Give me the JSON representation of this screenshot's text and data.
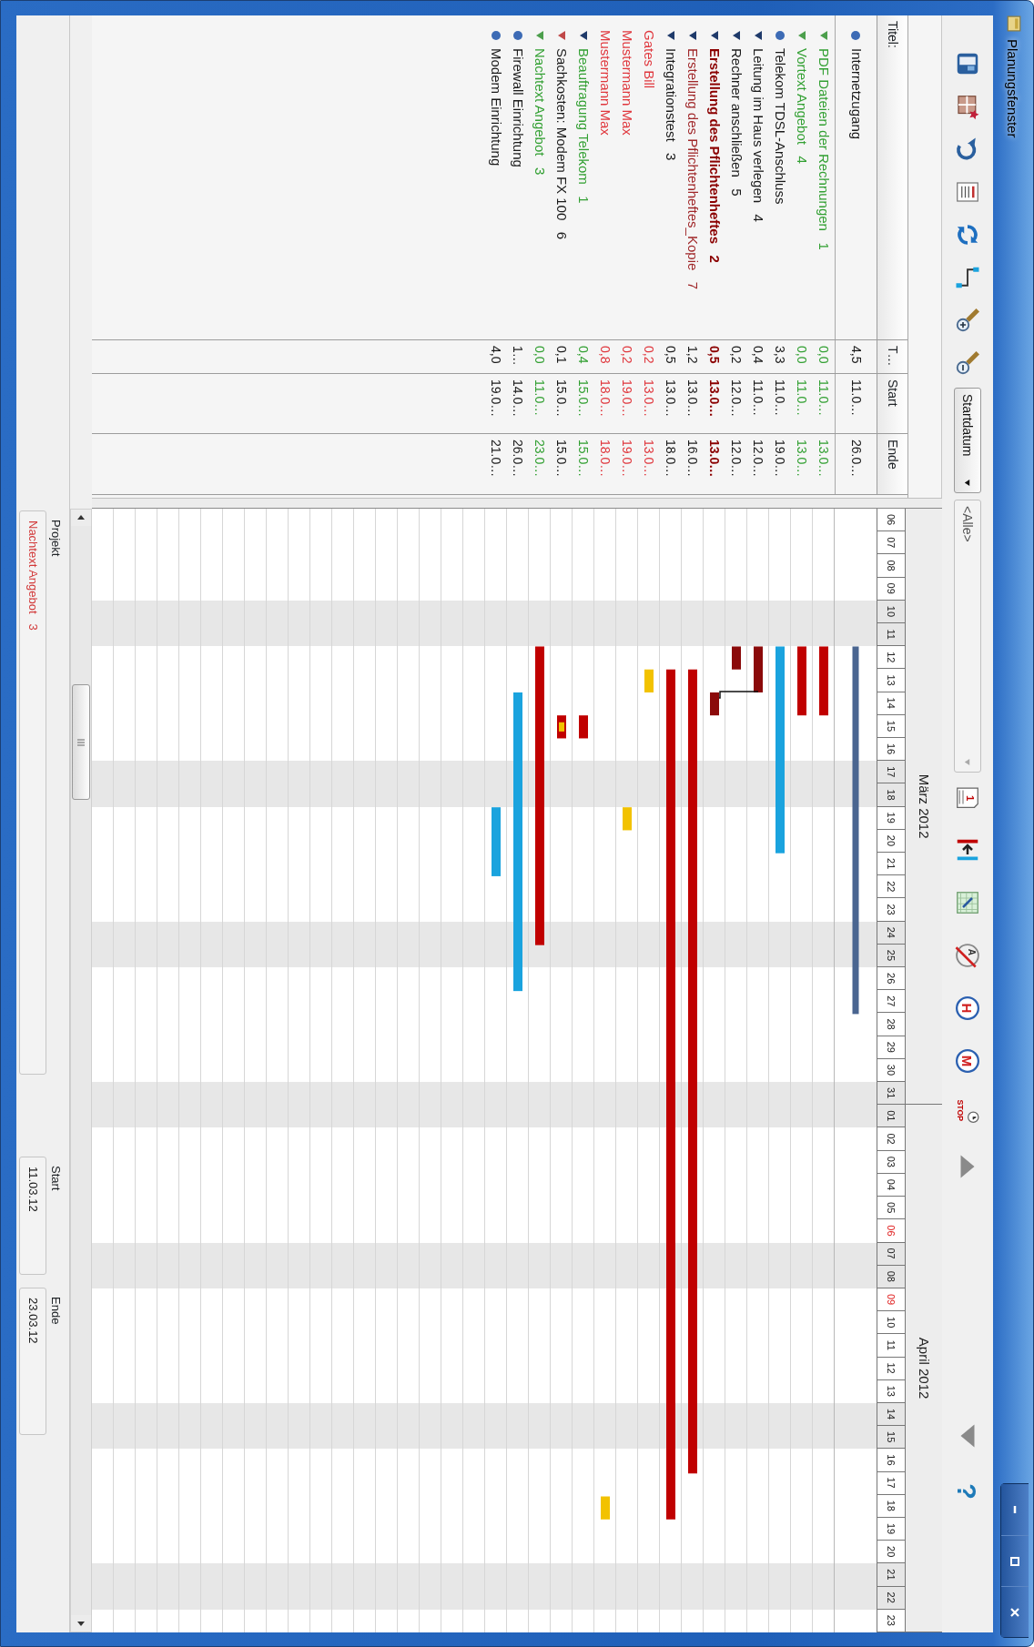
{
  "window": {
    "title": "Planungsfenster"
  },
  "toolbar": {
    "groups": [
      {
        "items": [
          {
            "kind": "icon"
          },
          {
            "kind": "icon"
          },
          {
            "kind": "icon"
          },
          {
            "kind": "icon"
          },
          {
            "kind": "icon"
          },
          {
            "kind": "icon"
          },
          {
            "kind": "icon"
          },
          {
            "kind": "icon"
          },
          {
            "kind": "dropdown",
            "value": "Startdatum",
            "disabled": false
          },
          {
            "kind": "dropdown",
            "value": "<Alle>",
            "disabled": true
          }
        ]
      },
      {
        "items": [
          {
            "kind": "icon",
            "glyph": "1"
          },
          {
            "kind": "icon"
          },
          {
            "kind": "icon"
          },
          {
            "kind": "icon",
            "glyph": "A"
          },
          {
            "kind": "icon",
            "glyph": "H"
          },
          {
            "kind": "icon",
            "glyph": "M"
          },
          {
            "kind": "icon",
            "glyph": "STOP"
          },
          {
            "kind": "icon"
          }
        ]
      },
      {
        "items": [
          {
            "kind": "icon"
          },
          {
            "kind": "icon",
            "glyph": "?"
          }
        ]
      }
    ]
  },
  "columns": [
    "Titel:",
    "T…",
    "Start",
    "Ende"
  ],
  "project": {
    "kind": "item",
    "marker": {
      "color": "#3d6bb5"
    },
    "cells": [
      {
        "text": "Internetzugang",
        "color": "#1a1a1a"
      },
      {
        "text": "4,5",
        "color": "#1a1a1a"
      },
      {
        "text": "11.0…",
        "color": "#1a1a1a"
      },
      {
        "text": "26.0…",
        "color": "#1a1a1a"
      }
    ]
  },
  "tasks": [
    {
      "kind": "group",
      "bold": false,
      "marker": {
        "color": "#4c9f4c"
      },
      "cells": [
        {
          "text": "PDF Dateien der Rechnungen   1",
          "color": "#33a033"
        },
        {
          "text": "0,0",
          "color": "#33a033"
        },
        {
          "text": "11.0…",
          "color": "#33a033"
        },
        {
          "text": "13.0…",
          "color": "#33a033"
        }
      ]
    },
    {
      "kind": "group",
      "bold": false,
      "marker": {
        "color": "#4c9f4c"
      },
      "cells": [
        {
          "text": "Vortext Angebot   4",
          "color": "#33a033"
        },
        {
          "text": "0,0",
          "color": "#33a033"
        },
        {
          "text": "11.0…",
          "color": "#33a033"
        },
        {
          "text": "13.0…",
          "color": "#33a033"
        }
      ]
    },
    {
      "kind": "item",
      "bold": false,
      "marker": {
        "color": "#3d6bb5"
      },
      "cells": [
        {
          "text": "Telekom TDSL-Anschluss",
          "color": "#1a1a1a"
        },
        {
          "text": "3,3",
          "color": "#1a1a1a"
        },
        {
          "text": "11.0…",
          "color": "#1a1a1a"
        },
        {
          "text": "19.0…",
          "color": "#1a1a1a"
        }
      ]
    },
    {
      "kind": "group",
      "bold": false,
      "marker": {
        "color": "#1f3a6a"
      },
      "cells": [
        {
          "text": "Leitung im Haus verlegen   4",
          "color": "#1a1a1a"
        },
        {
          "text": "0,4",
          "color": "#1a1a1a"
        },
        {
          "text": "11.0…",
          "color": "#1a1a1a"
        },
        {
          "text": "12.0…",
          "color": "#1a1a1a"
        }
      ]
    },
    {
      "kind": "group",
      "bold": false,
      "marker": {
        "color": "#1f3a6a"
      },
      "cells": [
        {
          "text": "Rechner anschließen   5",
          "color": "#1a1a1a"
        },
        {
          "text": "0,2",
          "color": "#1a1a1a"
        },
        {
          "text": "12.0…",
          "color": "#1a1a1a"
        },
        {
          "text": "12.0…",
          "color": "#1a1a1a"
        }
      ]
    },
    {
      "kind": "group",
      "bold": true,
      "marker": {
        "color": "#1f3a6a"
      },
      "cells": [
        {
          "text": "Erstellung des Pflichtenheftes   2",
          "color": "#8b0000"
        },
        {
          "text": "0,5",
          "color": "#8b0000"
        },
        {
          "text": "13.0…",
          "color": "#8b0000"
        },
        {
          "text": "13.0…",
          "color": "#8b0000"
        }
      ]
    },
    {
      "kind": "group",
      "bold": false,
      "marker": {
        "color": "#1f3a6a"
      },
      "cells": [
        {
          "text": "Erstellung des Pflichtenheftes_Kopie   7",
          "color": "#a0282a"
        },
        {
          "text": "1,2",
          "color": "#1a1a1a"
        },
        {
          "text": "13.0…",
          "color": "#1a1a1a"
        },
        {
          "text": "16.0…",
          "color": "#1a1a1a"
        }
      ]
    },
    {
      "kind": "group",
      "bold": false,
      "marker": {
        "color": "#1f3a6a"
      },
      "cells": [
        {
          "text": "Integrationstest   3",
          "color": "#1a1a1a"
        },
        {
          "text": "0,5",
          "color": "#1a1a1a"
        },
        {
          "text": "13.0…",
          "color": "#1a1a1a"
        },
        {
          "text": "18.0…",
          "color": "#1a1a1a"
        }
      ]
    },
    {
      "kind": "resource",
      "bold": false,
      "cells": [
        {
          "text": "Gates Bill",
          "color": "#e0383e"
        },
        {
          "text": "0,2",
          "color": "#e0383e"
        },
        {
          "text": "13.0…",
          "color": "#e0383e"
        },
        {
          "text": "13.0…",
          "color": "#e0383e"
        }
      ]
    },
    {
      "kind": "resource",
      "bold": false,
      "cells": [
        {
          "text": "Mustermann Max",
          "color": "#e0383e"
        },
        {
          "text": "0,2",
          "color": "#e0383e"
        },
        {
          "text": "19.0…",
          "color": "#e0383e"
        },
        {
          "text": "19.0…",
          "color": "#e0383e"
        }
      ]
    },
    {
      "kind": "resource",
      "bold": false,
      "cells": [
        {
          "text": "Mustermann Max",
          "color": "#e0383e"
        },
        {
          "text": "0,8",
          "color": "#e0383e"
        },
        {
          "text": "18.0…",
          "color": "#e0383e"
        },
        {
          "text": "18.0…",
          "color": "#e0383e"
        }
      ]
    },
    {
      "kind": "group",
      "bold": false,
      "marker": {
        "color": "#1f3a6a"
      },
      "cells": [
        {
          "text": "Beauftragung Telekom   1",
          "color": "#33a033"
        },
        {
          "text": "0,4",
          "color": "#33a033"
        },
        {
          "text": "15.0…",
          "color": "#33a033"
        },
        {
          "text": "15.0…",
          "color": "#33a033"
        }
      ]
    },
    {
      "kind": "group",
      "bold": false,
      "marker": {
        "color": "#c04848"
      },
      "cells": [
        {
          "text": "Sachkosten: Modem FX 100   6",
          "color": "#1a1a1a"
        },
        {
          "text": "0,1",
          "color": "#1a1a1a"
        },
        {
          "text": "15.0…",
          "color": "#1a1a1a"
        },
        {
          "text": "15.0…",
          "color": "#1a1a1a"
        }
      ]
    },
    {
      "kind": "group",
      "bold": false,
      "marker": {
        "color": "#4c9f4c"
      },
      "cells": [
        {
          "text": "Nachtext Angebot   3",
          "color": "#33a033"
        },
        {
          "text": "0,0",
          "color": "#33a033"
        },
        {
          "text": "11.0…",
          "color": "#33a033"
        },
        {
          "text": "23.0…",
          "color": "#33a033"
        }
      ]
    },
    {
      "kind": "item",
      "bold": false,
      "marker": {
        "color": "#3d6bb5"
      },
      "cells": [
        {
          "text": "Firewall Einrichtung",
          "color": "#1a1a1a"
        },
        {
          "text": "1…",
          "color": "#1a1a1a"
        },
        {
          "text": "14.0…",
          "color": "#1a1a1a"
        },
        {
          "text": "26.0…",
          "color": "#1a1a1a"
        }
      ]
    },
    {
      "kind": "item",
      "bold": false,
      "marker": {
        "color": "#3d6bb5"
      },
      "cells": [
        {
          "text": "Modem Einrichtung",
          "color": "#1a1a1a"
        },
        {
          "text": "4,0",
          "color": "#1a1a1a"
        },
        {
          "text": "19.0…",
          "color": "#1a1a1a"
        },
        {
          "text": "21.0…",
          "color": "#1a1a1a"
        }
      ]
    }
  ],
  "gantt": {
    "months": [
      {
        "label": "März 2012"
      },
      {
        "label": "April 2012"
      }
    ],
    "days": [
      {
        "label": "06",
        "weekend": false,
        "holiday": false
      },
      {
        "label": "07",
        "weekend": false,
        "holiday": false
      },
      {
        "label": "08",
        "weekend": false,
        "holiday": false
      },
      {
        "label": "09",
        "weekend": false,
        "holiday": false
      },
      {
        "label": "10",
        "weekend": true,
        "holiday": false
      },
      {
        "label": "11",
        "weekend": true,
        "holiday": false
      },
      {
        "label": "12",
        "weekend": false,
        "holiday": false
      },
      {
        "label": "13",
        "weekend": false,
        "holiday": false
      },
      {
        "label": "14",
        "weekend": false,
        "holiday": false
      },
      {
        "label": "15",
        "weekend": false,
        "holiday": false
      },
      {
        "label": "16",
        "weekend": false,
        "holiday": false
      },
      {
        "label": "17",
        "weekend": true,
        "holiday": false
      },
      {
        "label": "18",
        "weekend": true,
        "holiday": false
      },
      {
        "label": "19",
        "weekend": false,
        "holiday": false
      },
      {
        "label": "20",
        "weekend": false,
        "holiday": false
      },
      {
        "label": "21",
        "weekend": false,
        "holiday": false
      },
      {
        "label": "22",
        "weekend": false,
        "holiday": false
      },
      {
        "label": "23",
        "weekend": false,
        "holiday": false
      },
      {
        "label": "24",
        "weekend": true,
        "holiday": false
      },
      {
        "label": "25",
        "weekend": true,
        "holiday": false
      },
      {
        "label": "26",
        "weekend": false,
        "holiday": false
      },
      {
        "label": "27",
        "weekend": false,
        "holiday": false
      },
      {
        "label": "28",
        "weekend": false,
        "holiday": false
      },
      {
        "label": "29",
        "weekend": false,
        "holiday": false
      },
      {
        "label": "30",
        "weekend": false,
        "holiday": false
      },
      {
        "label": "31",
        "weekend": true,
        "holiday": false
      },
      {
        "label": "01",
        "weekend": true,
        "holiday": false
      },
      {
        "label": "02",
        "weekend": false,
        "holiday": false
      },
      {
        "label": "03",
        "weekend": false,
        "holiday": false
      },
      {
        "label": "04",
        "weekend": false,
        "holiday": false
      },
      {
        "label": "05",
        "weekend": false,
        "holiday": false
      },
      {
        "label": "06",
        "weekend": false,
        "holiday": true
      },
      {
        "label": "07",
        "weekend": true,
        "holiday": false
      },
      {
        "label": "08",
        "weekend": true,
        "holiday": false
      },
      {
        "label": "09",
        "weekend": false,
        "holiday": true
      },
      {
        "label": "10",
        "weekend": false,
        "holiday": false
      },
      {
        "label": "11",
        "weekend": false,
        "holiday": false
      },
      {
        "label": "12",
        "weekend": false,
        "holiday": false
      },
      {
        "label": "13",
        "weekend": false,
        "holiday": false
      },
      {
        "label": "14",
        "weekend": true,
        "holiday": false
      },
      {
        "label": "15",
        "weekend": true,
        "holiday": false
      },
      {
        "label": "16",
        "weekend": false,
        "holiday": false
      },
      {
        "label": "17",
        "weekend": false,
        "holiday": false
      },
      {
        "label": "18",
        "weekend": false,
        "holiday": false
      },
      {
        "label": "19",
        "weekend": false,
        "holiday": false
      },
      {
        "label": "20",
        "weekend": false,
        "holiday": false
      },
      {
        "label": "21",
        "weekend": true,
        "holiday": false
      },
      {
        "label": "22",
        "weekend": true,
        "holiday": false
      },
      {
        "label": "23",
        "weekend": false,
        "holiday": false
      }
    ]
  },
  "status": {
    "fields": [
      {
        "label": "Projekt",
        "value": "Nachtext Angebot   3",
        "color": "#d23a3a"
      },
      {
        "label": "Start",
        "value": "11.03.12",
        "color": "#1a1a1a"
      },
      {
        "label": "Ende",
        "value": "23.03.12",
        "color": "#1a1a1a"
      }
    ]
  }
}
